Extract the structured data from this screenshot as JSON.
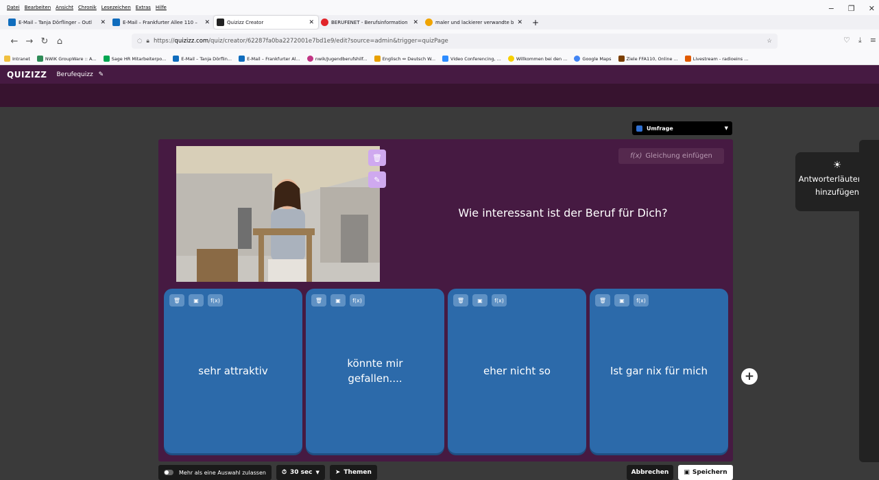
{
  "menu": [
    "Datei",
    "Bearbeiten",
    "Ansicht",
    "Chronik",
    "Lesezeichen",
    "Extras",
    "Hilfe"
  ],
  "window_controls": [
    "−",
    "❐",
    "✕"
  ],
  "tabs": [
    {
      "label": "E-Mail – Tanja Dörflinger – Outl",
      "color": "#0f6cbd"
    },
    {
      "label": "E-Mail – Frankfurter Allee 110 –",
      "color": "#0f6cbd"
    },
    {
      "label": "Quizizz Creator",
      "color": "#222"
    },
    {
      "label": "BERUFENET - Berufsinformation",
      "color": "#e1242a"
    },
    {
      "label": "maler und lackierer verwandte b",
      "color": "#f0a400"
    }
  ],
  "url": {
    "scheme": "https://",
    "host": "quizizz.com",
    "path": "/quiz/creator/62287fa0ba2272001e7bd1e9/edit?source=admin&trigger=quizPage"
  },
  "bookmarks": [
    "Intranet",
    "NWiK GroupWare :: A...",
    "Sage HR Mitarbeiterpo...",
    "E-Mail – Tanja Dörflin...",
    "E-Mail – Frankfurter Al...",
    "nwik/Jugendberufshilf...",
    "Englisch ⇔ Deutsch W...",
    "Video Conferencing, ...",
    "Willkommen bei den ...",
    "Google Maps",
    "Ziele FFA110, Online ...",
    "Livestream - radioeins ..."
  ],
  "app": {
    "logo": "QUIZIZZ",
    "quiz_name": "Berufequizz"
  },
  "question_type": "Umfrage",
  "equation_button": "Gleichung einfügen",
  "question_text": "Wie interessant ist der Beruf für Dich?",
  "answers": [
    "sehr attraktiv",
    "könnte mir gefallen....",
    "eher nicht so",
    "Ist gar nix für mich"
  ],
  "explanation": {
    "line1": "Antworterläuterung",
    "line2": "hinzufügen"
  },
  "bottom": {
    "multi_select": "Mehr als eine Auswahl zulassen",
    "timer": "30 sec",
    "themes": "Themen",
    "cancel": "Abbrechen",
    "save": "Speichern"
  },
  "colors": {
    "header": "#461a42",
    "answer": "#2c6aaa",
    "background": "#3a3a3a"
  }
}
